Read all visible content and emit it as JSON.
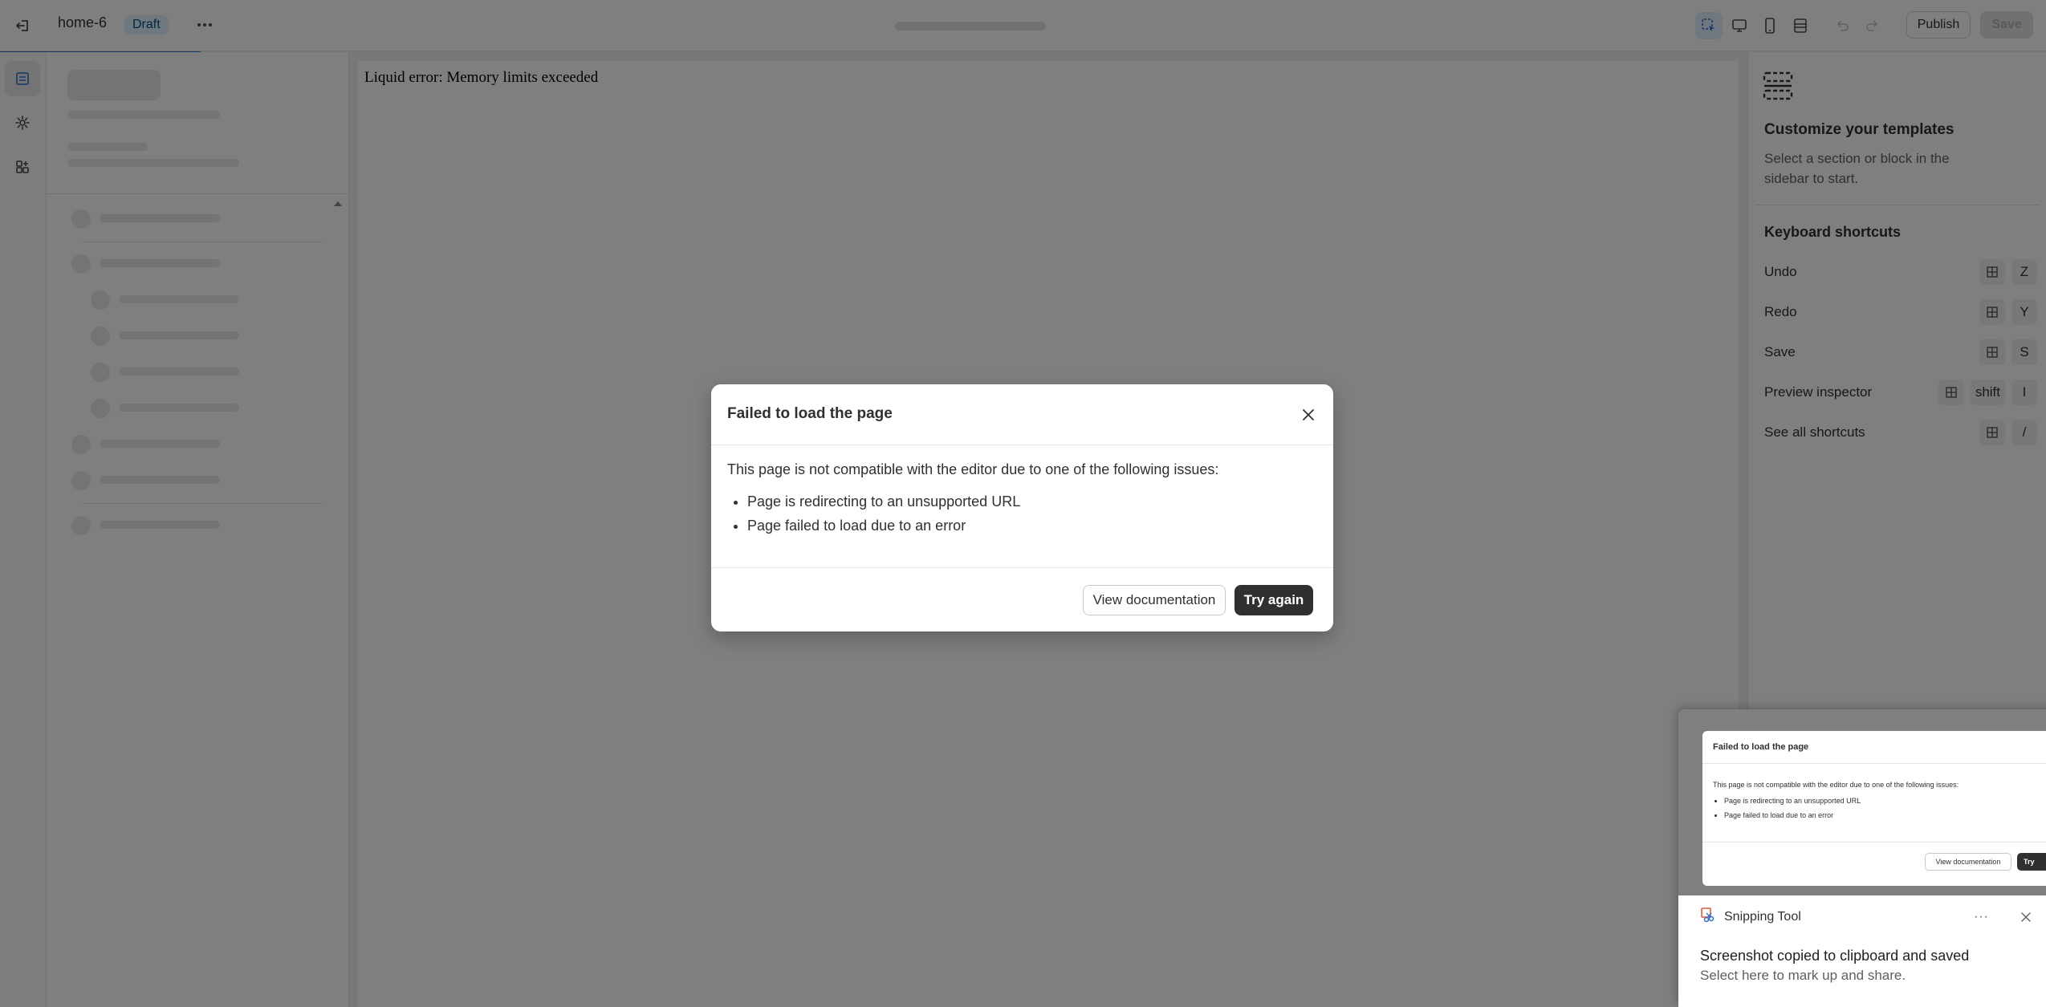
{
  "topbar": {
    "template_name": "home-6",
    "status_badge": "Draft",
    "publish_label": "Publish",
    "save_label": "Save"
  },
  "preview": {
    "error_text": "Liquid error: Memory limits exceeded"
  },
  "right_panel": {
    "title": "Customize your templates",
    "description": "Select a section or block in the sidebar to start.",
    "shortcuts_title": "Keyboard shortcuts",
    "shortcuts": [
      {
        "label": "Undo",
        "keys": [
          "Z"
        ]
      },
      {
        "label": "Redo",
        "keys": [
          "Y"
        ]
      },
      {
        "label": "Save",
        "keys": [
          "S"
        ]
      },
      {
        "label": "Preview inspector",
        "keys": [
          "shift",
          "I"
        ]
      },
      {
        "label": "See all shortcuts",
        "keys": [
          "/"
        ]
      }
    ]
  },
  "modal": {
    "title": "Failed to load the page",
    "intro": "This page is not compatible with the editor due to one of the following issues:",
    "issues": [
      "Page is redirecting to an unsupported URL",
      "Page failed to load due to an error"
    ],
    "view_docs_label": "View documentation",
    "try_again_label": "Try again"
  },
  "snipping_tool": {
    "app_name": "Snipping Tool",
    "message": "Screenshot copied to clipboard and saved",
    "sub_message": "Select here to mark up and share.",
    "more_label": "···",
    "thumbnail": {
      "title": "Failed to load the page",
      "intro": "This page is not compatible with the editor due to one of the following issues:",
      "issues": [
        "Page is redirecting to an unsupported URL",
        "Page failed to load due to an error"
      ],
      "view_docs_label": "View documentation",
      "try_label": "Try"
    }
  },
  "colors": {
    "accent": "#2c6ecb",
    "draft_badge_bg": "#e0f0ff",
    "primary_button": "#303030",
    "overlay": "rgba(0,0,0,0.5)"
  }
}
